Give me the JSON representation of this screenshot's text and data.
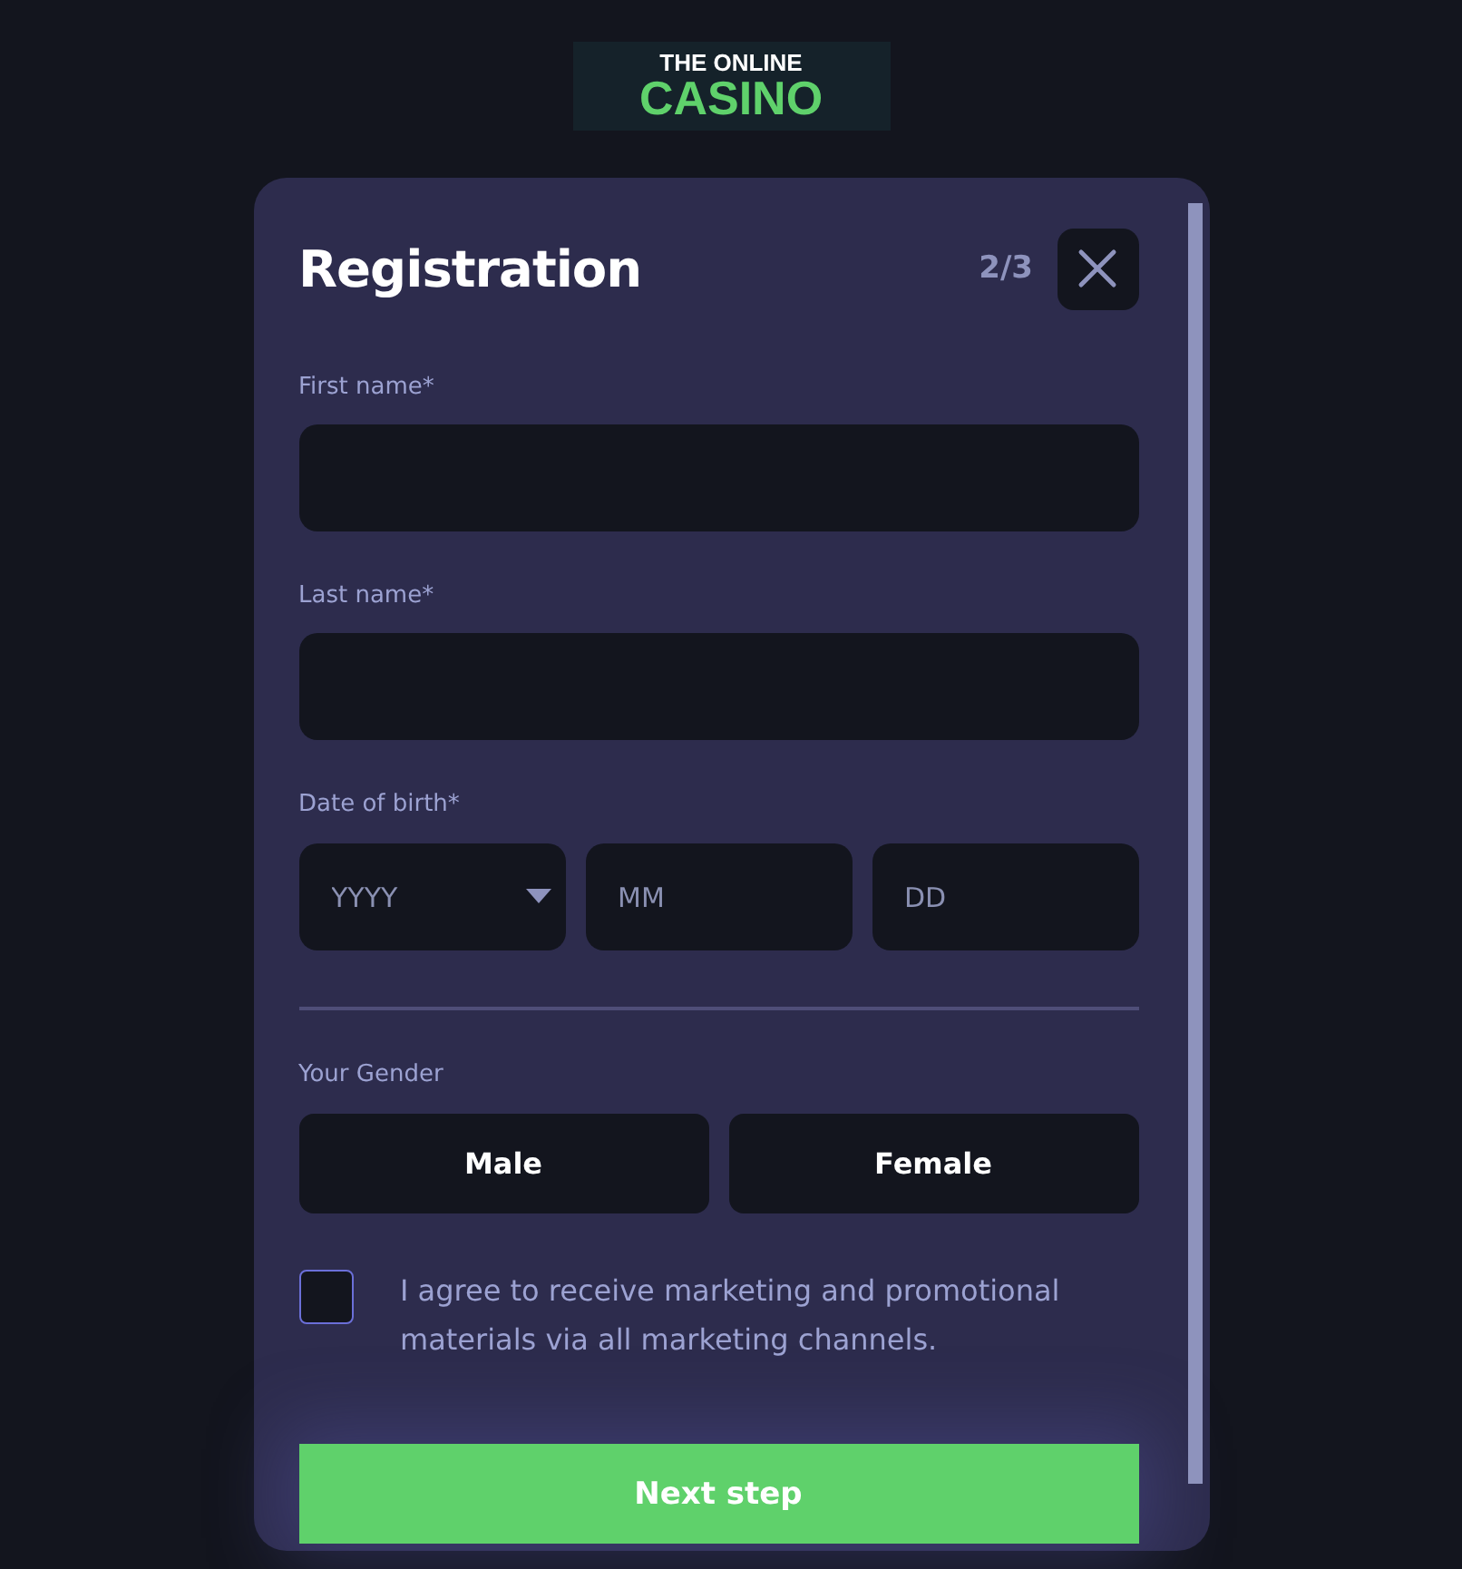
{
  "logo": {
    "line_1": "THE ONLINE",
    "line_2": "CASINO"
  },
  "dialog": {
    "title": "Registration",
    "step": "2/3",
    "fields": [
      {
        "label": "First name*"
      },
      {
        "label": "Last name*"
      }
    ],
    "date_of_birth": {
      "label": "Date of birth*",
      "parts": [
        {
          "kind": "dropdown",
          "placeholder": "YYYY"
        },
        {
          "kind": "text",
          "placeholder": "MM"
        },
        {
          "kind": "text",
          "placeholder": "DD"
        }
      ]
    },
    "gender": {
      "label": "Your Gender",
      "options": [
        {
          "label": "Male",
          "selected": false
        },
        {
          "label": "Female",
          "selected": false
        }
      ]
    },
    "consent": {
      "checked": false,
      "text": "I agree to receive marketing and promotional materials via all marketing channels."
    },
    "submit": "Next step"
  }
}
